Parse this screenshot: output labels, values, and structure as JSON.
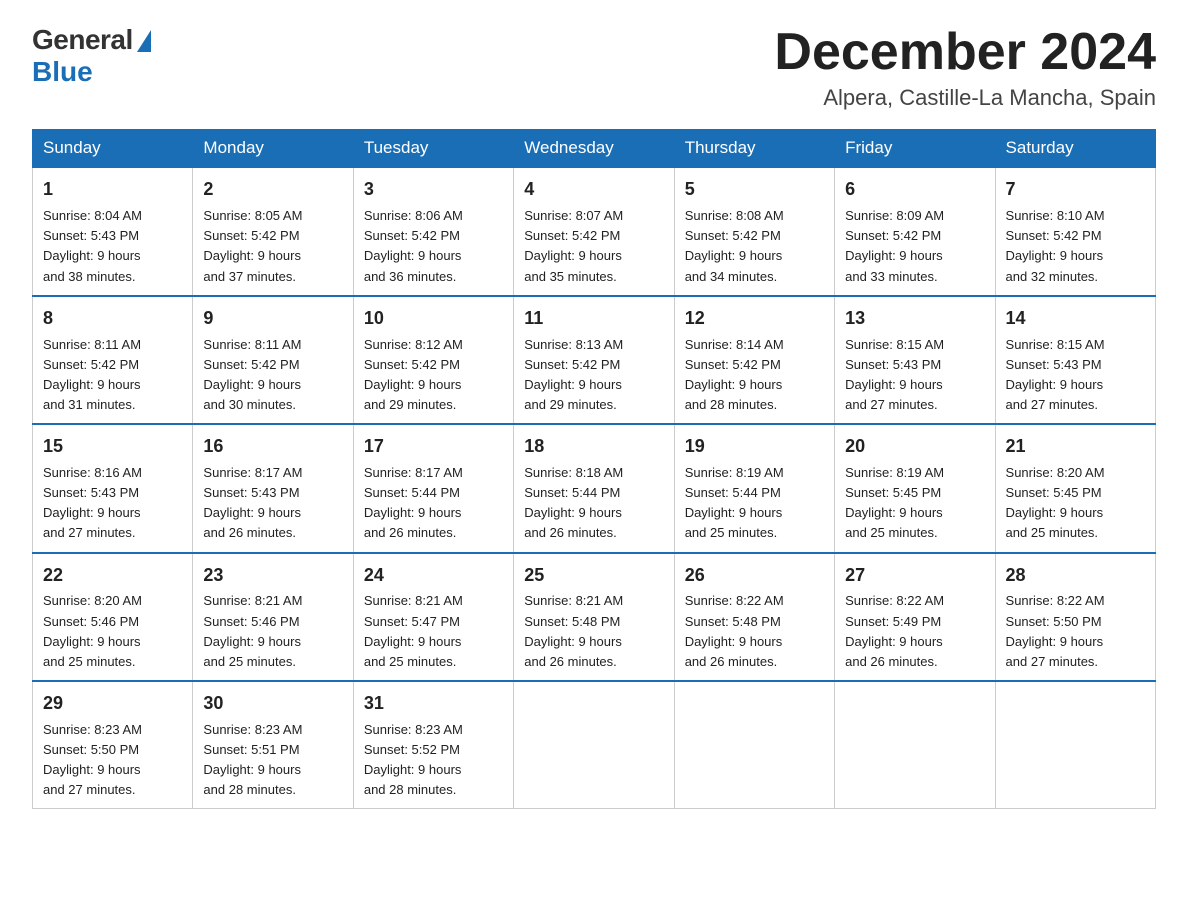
{
  "header": {
    "logo_general": "General",
    "logo_blue": "Blue",
    "month_title": "December 2024",
    "subtitle": "Alpera, Castille-La Mancha, Spain"
  },
  "weekdays": [
    "Sunday",
    "Monday",
    "Tuesday",
    "Wednesday",
    "Thursday",
    "Friday",
    "Saturday"
  ],
  "weeks": [
    [
      {
        "day": "1",
        "sunrise": "8:04 AM",
        "sunset": "5:43 PM",
        "daylight": "9 hours and 38 minutes."
      },
      {
        "day": "2",
        "sunrise": "8:05 AM",
        "sunset": "5:42 PM",
        "daylight": "9 hours and 37 minutes."
      },
      {
        "day": "3",
        "sunrise": "8:06 AM",
        "sunset": "5:42 PM",
        "daylight": "9 hours and 36 minutes."
      },
      {
        "day": "4",
        "sunrise": "8:07 AM",
        "sunset": "5:42 PM",
        "daylight": "9 hours and 35 minutes."
      },
      {
        "day": "5",
        "sunrise": "8:08 AM",
        "sunset": "5:42 PM",
        "daylight": "9 hours and 34 minutes."
      },
      {
        "day": "6",
        "sunrise": "8:09 AM",
        "sunset": "5:42 PM",
        "daylight": "9 hours and 33 minutes."
      },
      {
        "day": "7",
        "sunrise": "8:10 AM",
        "sunset": "5:42 PM",
        "daylight": "9 hours and 32 minutes."
      }
    ],
    [
      {
        "day": "8",
        "sunrise": "8:11 AM",
        "sunset": "5:42 PM",
        "daylight": "9 hours and 31 minutes."
      },
      {
        "day": "9",
        "sunrise": "8:11 AM",
        "sunset": "5:42 PM",
        "daylight": "9 hours and 30 minutes."
      },
      {
        "day": "10",
        "sunrise": "8:12 AM",
        "sunset": "5:42 PM",
        "daylight": "9 hours and 29 minutes."
      },
      {
        "day": "11",
        "sunrise": "8:13 AM",
        "sunset": "5:42 PM",
        "daylight": "9 hours and 29 minutes."
      },
      {
        "day": "12",
        "sunrise": "8:14 AM",
        "sunset": "5:42 PM",
        "daylight": "9 hours and 28 minutes."
      },
      {
        "day": "13",
        "sunrise": "8:15 AM",
        "sunset": "5:43 PM",
        "daylight": "9 hours and 27 minutes."
      },
      {
        "day": "14",
        "sunrise": "8:15 AM",
        "sunset": "5:43 PM",
        "daylight": "9 hours and 27 minutes."
      }
    ],
    [
      {
        "day": "15",
        "sunrise": "8:16 AM",
        "sunset": "5:43 PM",
        "daylight": "9 hours and 27 minutes."
      },
      {
        "day": "16",
        "sunrise": "8:17 AM",
        "sunset": "5:43 PM",
        "daylight": "9 hours and 26 minutes."
      },
      {
        "day": "17",
        "sunrise": "8:17 AM",
        "sunset": "5:44 PM",
        "daylight": "9 hours and 26 minutes."
      },
      {
        "day": "18",
        "sunrise": "8:18 AM",
        "sunset": "5:44 PM",
        "daylight": "9 hours and 26 minutes."
      },
      {
        "day": "19",
        "sunrise": "8:19 AM",
        "sunset": "5:44 PM",
        "daylight": "9 hours and 25 minutes."
      },
      {
        "day": "20",
        "sunrise": "8:19 AM",
        "sunset": "5:45 PM",
        "daylight": "9 hours and 25 minutes."
      },
      {
        "day": "21",
        "sunrise": "8:20 AM",
        "sunset": "5:45 PM",
        "daylight": "9 hours and 25 minutes."
      }
    ],
    [
      {
        "day": "22",
        "sunrise": "8:20 AM",
        "sunset": "5:46 PM",
        "daylight": "9 hours and 25 minutes."
      },
      {
        "day": "23",
        "sunrise": "8:21 AM",
        "sunset": "5:46 PM",
        "daylight": "9 hours and 25 minutes."
      },
      {
        "day": "24",
        "sunrise": "8:21 AM",
        "sunset": "5:47 PM",
        "daylight": "9 hours and 25 minutes."
      },
      {
        "day": "25",
        "sunrise": "8:21 AM",
        "sunset": "5:48 PM",
        "daylight": "9 hours and 26 minutes."
      },
      {
        "day": "26",
        "sunrise": "8:22 AM",
        "sunset": "5:48 PM",
        "daylight": "9 hours and 26 minutes."
      },
      {
        "day": "27",
        "sunrise": "8:22 AM",
        "sunset": "5:49 PM",
        "daylight": "9 hours and 26 minutes."
      },
      {
        "day": "28",
        "sunrise": "8:22 AM",
        "sunset": "5:50 PM",
        "daylight": "9 hours and 27 minutes."
      }
    ],
    [
      {
        "day": "29",
        "sunrise": "8:23 AM",
        "sunset": "5:50 PM",
        "daylight": "9 hours and 27 minutes."
      },
      {
        "day": "30",
        "sunrise": "8:23 AM",
        "sunset": "5:51 PM",
        "daylight": "9 hours and 28 minutes."
      },
      {
        "day": "31",
        "sunrise": "8:23 AM",
        "sunset": "5:52 PM",
        "daylight": "9 hours and 28 minutes."
      },
      null,
      null,
      null,
      null
    ]
  ]
}
